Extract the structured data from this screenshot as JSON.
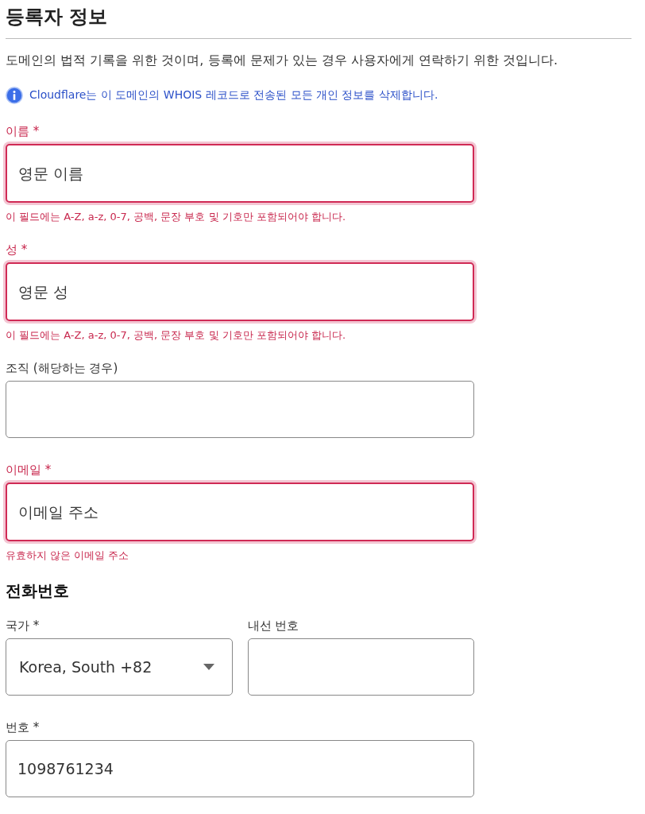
{
  "title": "등록자 정보",
  "description": "도메인의 법적 기록을 위한 것이며, 등록에 문제가 있는 경우 사용자에게 연락하기 위한 것입니다.",
  "notice": {
    "text": "Cloudflare는 이 도메인의 WHOIS 레코드로 전송된 모든 개인 정보를 삭제합니다."
  },
  "fields": [
    {
      "label": "이름 *",
      "placeholder": "영문 이름",
      "invalid": true,
      "error": "이 필드에는 A-Z, a-z, 0-7, 공백, 문장 부호 및 기호만 포함되어야 합니다."
    },
    {
      "label": "성 *",
      "placeholder": "영문 성",
      "invalid": true,
      "error": "이 필드에는 A-Z, a-z, 0-7, 공백, 문장 부호 및 기호만 포함되어야 합니다."
    },
    {
      "label": "조직 (해당하는 경우)",
      "invalid": false
    },
    {
      "label": "이메일 *",
      "placeholder": "이메일 주소",
      "invalid": true,
      "error": "유효하지 않은 이메일 주소"
    }
  ],
  "phone": {
    "heading": "전화번호",
    "country": {
      "label": "국가 *",
      "value": "Korea, South +82"
    },
    "extension": {
      "label": "내선 번호"
    },
    "number": {
      "label": "번호 *",
      "value": "1098761234"
    }
  }
}
